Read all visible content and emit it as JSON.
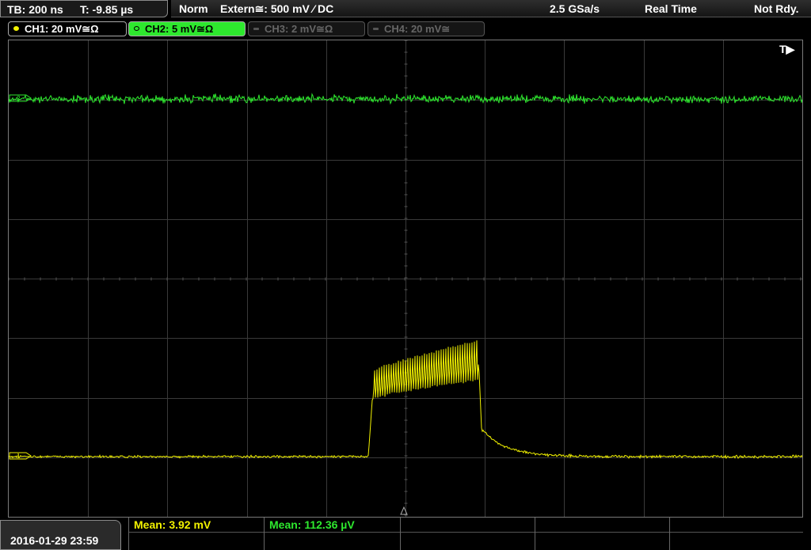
{
  "topbar": {
    "timebase": "TB: 200 ns",
    "trigger_time": "T: -9.85 µs",
    "mode": "Norm",
    "trigger_source": "Extern≅: 500 mV ⁄ DC",
    "sample_rate": "2.5 GSa/s",
    "acq_mode": "Real Time",
    "status": "Not Rdy."
  },
  "channels": [
    {
      "label": "CH1: 20 mV≅Ω",
      "color": "#f2f200",
      "active": true
    },
    {
      "label": "CH2: 5 mV≅Ω",
      "color": "#2ee82e",
      "active": true
    },
    {
      "label": "CH3: 2 mV≅Ω",
      "color": "#666666",
      "active": false
    },
    {
      "label": "CH4: 20 mV≅",
      "color": "#666666",
      "active": false
    }
  ],
  "screen": {
    "trigger_marker": "T▶",
    "ch1_ref": "1",
    "ch2_ref": "2"
  },
  "measurements": {
    "ch1_mean": "Mean: 3.92 mV",
    "ch2_mean": "Mean: 112.36 µV"
  },
  "datetime": "2016-01-29 23:59",
  "colors": {
    "ch1": "#f2f200",
    "ch2": "#2ee82e",
    "grid": "#3a3a3a"
  }
}
